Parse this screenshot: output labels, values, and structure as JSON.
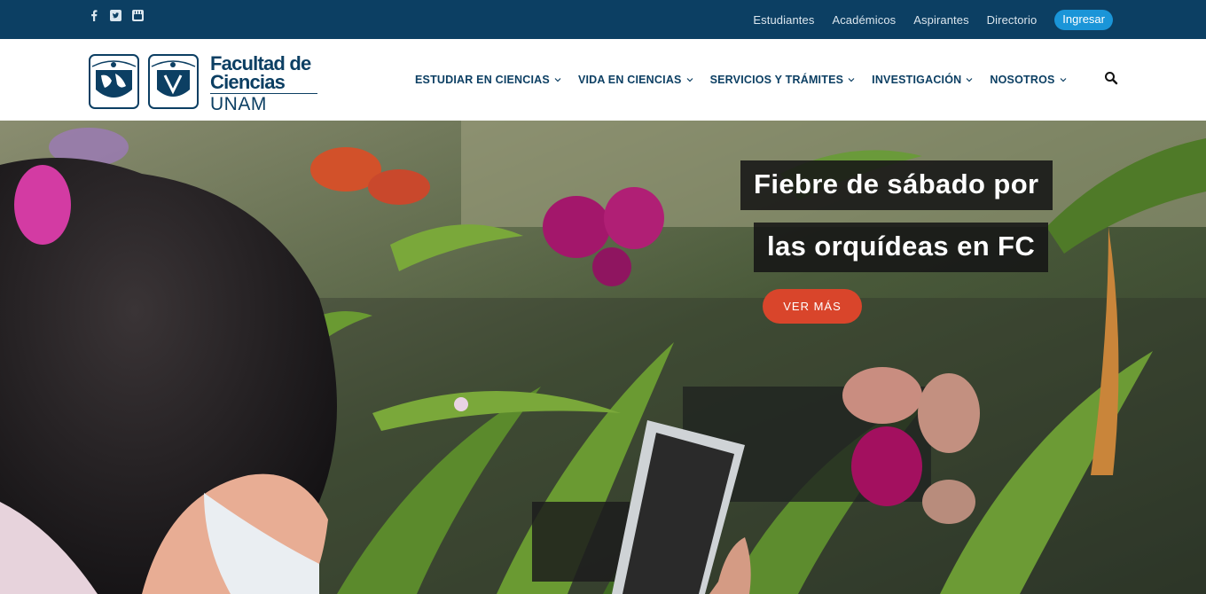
{
  "social": {
    "icons": [
      "facebook-icon",
      "twitter-icon",
      "youtube-icon"
    ]
  },
  "top_links": {
    "students": "Estudiantes",
    "academics": "Académicos",
    "applicants": "Aspirantes",
    "directory": "Directorio",
    "login": "Ingresar"
  },
  "brand": {
    "line1": "Facultad de",
    "line2": "Ciencias",
    "line3": "UNAM"
  },
  "menu": {
    "study": "ESTUDIAR EN CIENCIAS",
    "life": "VIDA EN CIENCIAS",
    "services": "SERVICIOS Y TRÁMITES",
    "research": "INVESTIGACIÓN",
    "about": "NOSOTROS"
  },
  "hero": {
    "title_line1": "Fiebre de sábado por",
    "title_line2": "las orquídeas en FC",
    "cta": "VER MÁS"
  },
  "colors": {
    "top_bar": "#0c3f63",
    "brand_navy": "#0c3f63",
    "login_button": "#1a95d8",
    "cta_button": "#d9452b"
  }
}
